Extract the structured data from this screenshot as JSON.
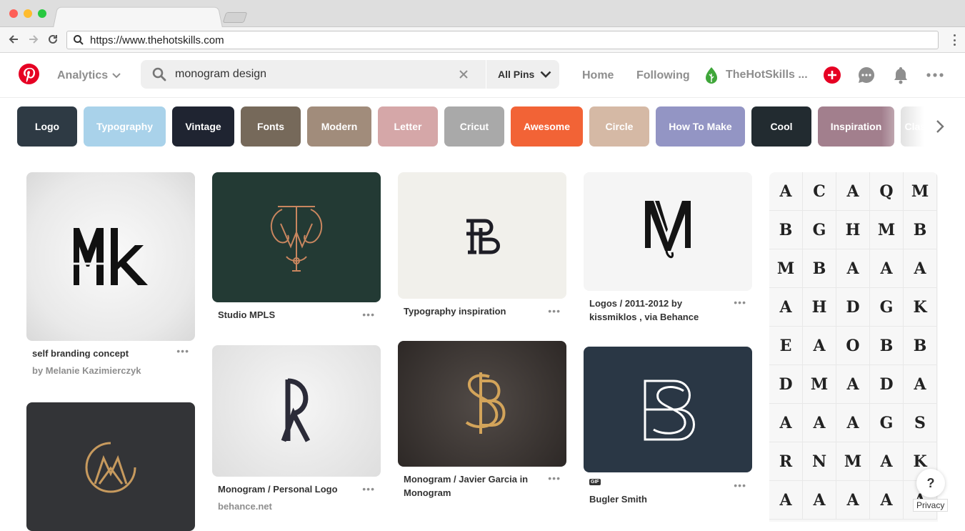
{
  "browser": {
    "url": "https://www.thehotskills.com",
    "traffic_colors": [
      "#fe5f57",
      "#febc2e",
      "#28c840"
    ]
  },
  "header": {
    "analytics_label": "Analytics",
    "search_query": "monogram design",
    "search_scope": "All Pins",
    "nav": [
      "Home",
      "Following"
    ],
    "profile_name": "TheHotSkills ...",
    "brand_color": "#e60023"
  },
  "chips": [
    {
      "label": "Logo",
      "color": "#2e3a44"
    },
    {
      "label": "Typography",
      "color": "#a9d2ea"
    },
    {
      "label": "Vintage",
      "color": "#1f2431"
    },
    {
      "label": "Fonts",
      "color": "#76695a"
    },
    {
      "label": "Modern",
      "color": "#a18c7b"
    },
    {
      "label": "Letter",
      "color": "#d5a7a8"
    },
    {
      "label": "Cricut",
      "color": "#a9a9a9"
    },
    {
      "label": "Awesome",
      "color": "#f26336"
    },
    {
      "label": "Circle",
      "color": "#d5b9a5"
    },
    {
      "label": "How To Make",
      "color": "#9395c4"
    },
    {
      "label": "Cool",
      "color": "#222b30"
    },
    {
      "label": "Inspiration",
      "color": "#a27f8d"
    },
    {
      "label": "Classic",
      "color": "#c9c9c9"
    }
  ],
  "pins": [
    {
      "id": "mk",
      "title": "self branding concept",
      "subtitle": "by Melanie Kazimierczyk",
      "art": "Mk"
    },
    {
      "id": "studio",
      "title": "Studio MPLS",
      "subtitle": "",
      "art": "TM"
    },
    {
      "id": "typo",
      "title": "Typography inspiration",
      "subtitle": "",
      "art": "PB"
    },
    {
      "id": "logos",
      "title": "Logos / 2011-2012 by kissmiklos , via Behance",
      "subtitle": "",
      "art": "MV"
    },
    {
      "id": "dark-m",
      "title": "",
      "subtitle": "",
      "art": "M"
    },
    {
      "id": "personal",
      "title": "Monogram / Personal Logo",
      "subtitle": "behance.net",
      "art": "R"
    },
    {
      "id": "garcia",
      "title": "Monogram / Javier Garcia in Monogram",
      "subtitle": "",
      "art": "SB"
    },
    {
      "id": "bugler",
      "title": "Bugler Smith",
      "subtitle": "",
      "badge": "GIF",
      "art": "B"
    }
  ],
  "monogram_grid_letters": [
    "A",
    "C",
    "A",
    "Q",
    "M",
    "B",
    "G",
    "H",
    "M",
    "B",
    "M",
    "B",
    "A",
    "A",
    "A",
    "A",
    "H",
    "D",
    "G",
    "K",
    "E",
    "A",
    "O",
    "B",
    "B",
    "D",
    "M",
    "A",
    "D",
    "A",
    "A",
    "A",
    "A",
    "G",
    "S",
    "R",
    "N",
    "M",
    "A",
    "K",
    "A",
    "A",
    "A",
    "A",
    "A"
  ],
  "footer": {
    "help": "?",
    "privacy": "Privacy"
  }
}
